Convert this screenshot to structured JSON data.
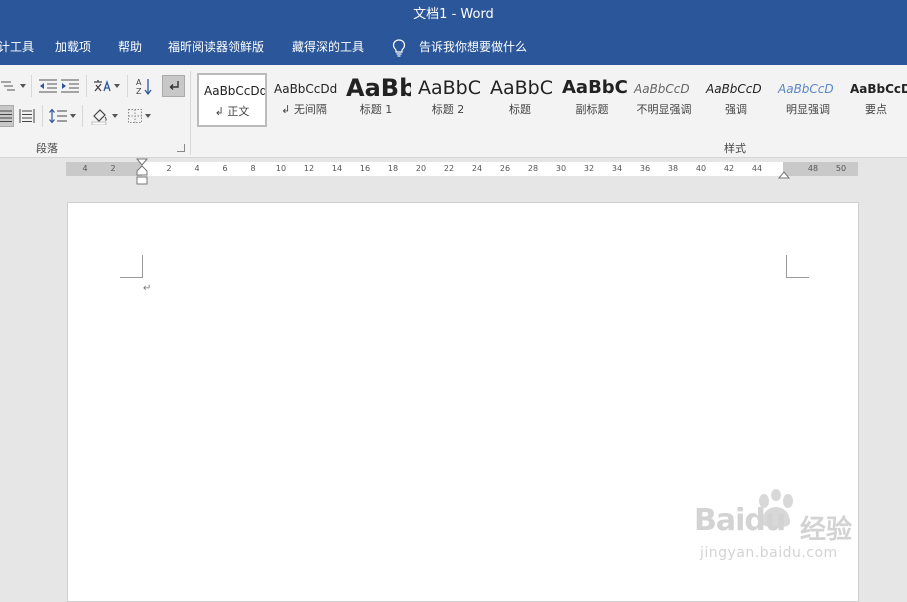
{
  "window": {
    "title": "文档1  -  Word"
  },
  "tabs": [
    {
      "label": "设计工具",
      "x": -14
    },
    {
      "label": "加载项"
    },
    {
      "label": "帮助"
    },
    {
      "label": "福昕阅读器领鲜版"
    },
    {
      "label": "藏得深的工具"
    },
    {
      "label": "告诉我你想要做什么"
    }
  ],
  "ribbon": {
    "groups": {
      "paragraph": "段落",
      "styles": "样式"
    },
    "styles": [
      {
        "preview": "AaBbCcDd",
        "name": "↲ 正文",
        "selected": true
      },
      {
        "preview": "AaBbCcDd",
        "name": "↲ 无间隔"
      },
      {
        "preview": "AaBb",
        "name": "标题 1"
      },
      {
        "preview": "AaBbC",
        "name": "标题 2"
      },
      {
        "preview": "AaBbC",
        "name": "标题"
      },
      {
        "preview": "AaBbC",
        "name": "副标题"
      },
      {
        "preview": "AaBbCcD",
        "name": "不明显强调"
      },
      {
        "preview": "AaBbCcD",
        "name": "强调"
      },
      {
        "preview": "AaBbCcD",
        "name": "明显强调"
      },
      {
        "preview": "AaBbCcDd",
        "name": "要点"
      }
    ],
    "colors": {
      "accent": "#2b579a"
    }
  },
  "ruler": {
    "left_numbers": [
      "4",
      "2"
    ],
    "right_numbers": [
      "2",
      "4",
      "6",
      "8",
      "10",
      "12",
      "14",
      "16",
      "18",
      "20",
      "22",
      "24",
      "26",
      "28",
      "30",
      "32",
      "34",
      "36",
      "38",
      "40",
      "42",
      "44"
    ],
    "margin_numbers": [
      "48",
      "50"
    ]
  },
  "document": {
    "paragraph_mark": "↵"
  },
  "watermark": {
    "logo": "Baidu",
    "cn": "经验",
    "url": "jingyan.baidu.com"
  }
}
